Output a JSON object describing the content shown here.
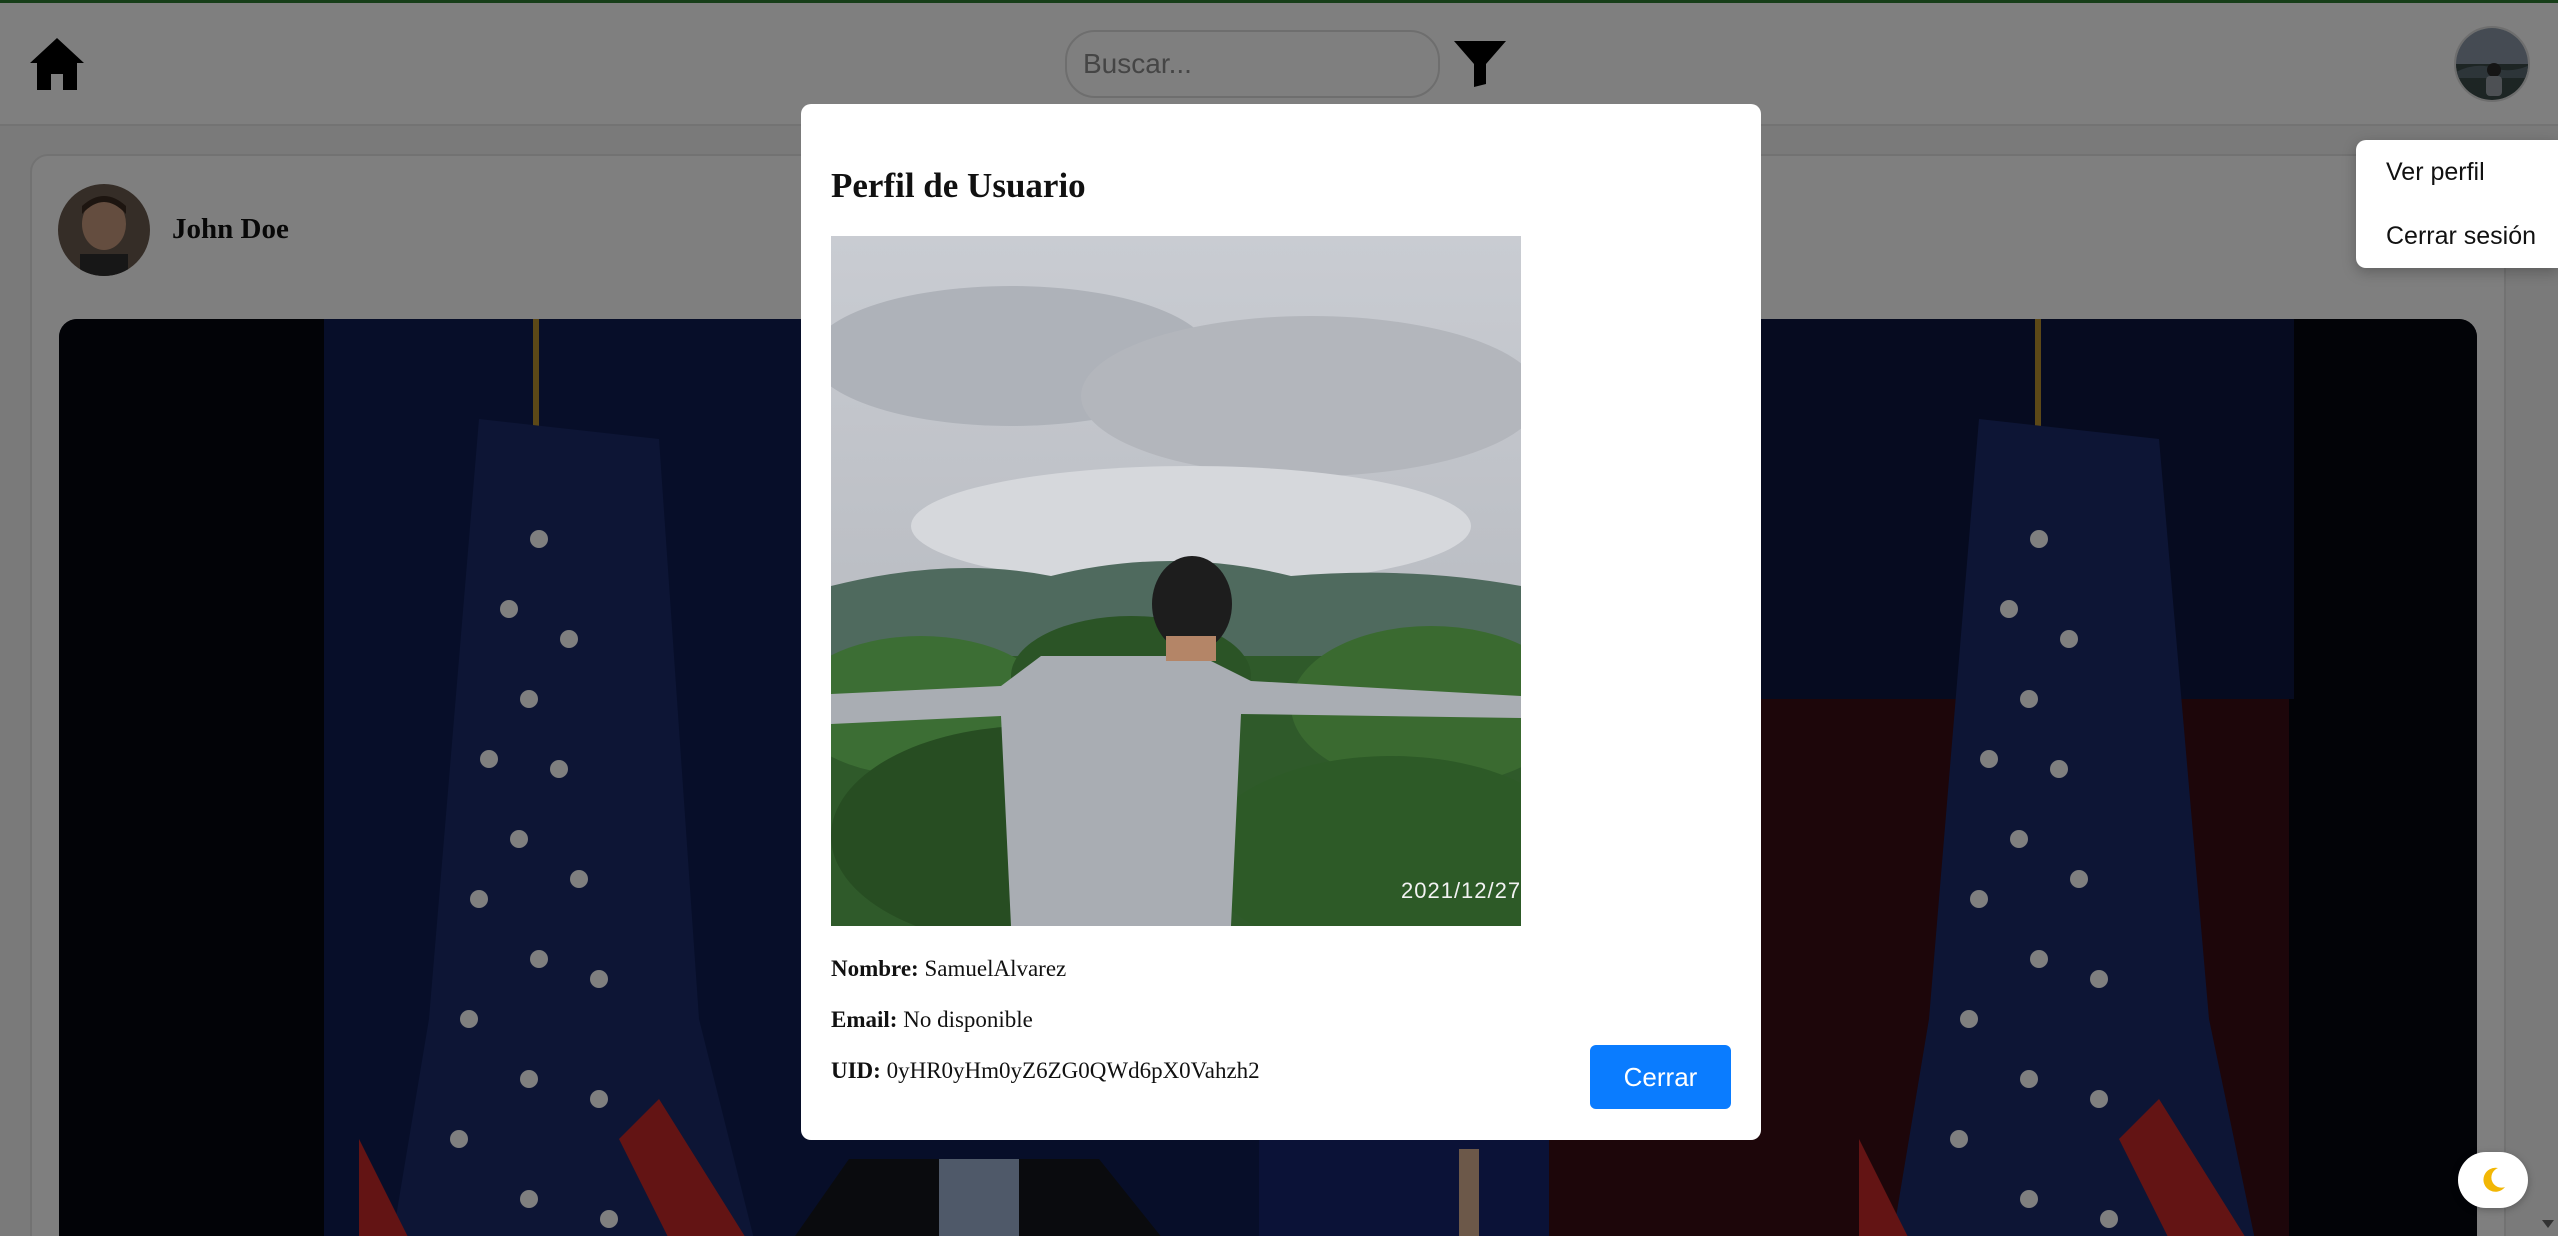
{
  "navbar": {
    "search_placeholder": "Buscar...",
    "icons": {
      "home": "home-icon",
      "filter": "filter-icon",
      "avatar": "user-avatar"
    }
  },
  "post": {
    "author_name": "John Doe"
  },
  "dropdown": {
    "items": [
      {
        "label": "Ver perfil"
      },
      {
        "label": "Cerrar sesión"
      }
    ]
  },
  "profile_modal": {
    "title": "Perfil de Usuario",
    "photo_date": "2021/12/27",
    "name_label": "Nombre:",
    "name_value": "SamuelAlvarez",
    "email_label": "Email:",
    "email_value": "No disponible",
    "uid_label": "UID:",
    "uid_value": "0yHR0yHm0yZ6ZG0QWd6pX0Vahzh2",
    "close_label": "Cerrar"
  },
  "theme_toggle": {
    "icon": "moon-icon"
  },
  "colors": {
    "accent": "#0a7cff",
    "top_line": "#2e7d32",
    "overlay": "rgba(0,0,0,0.5)"
  }
}
